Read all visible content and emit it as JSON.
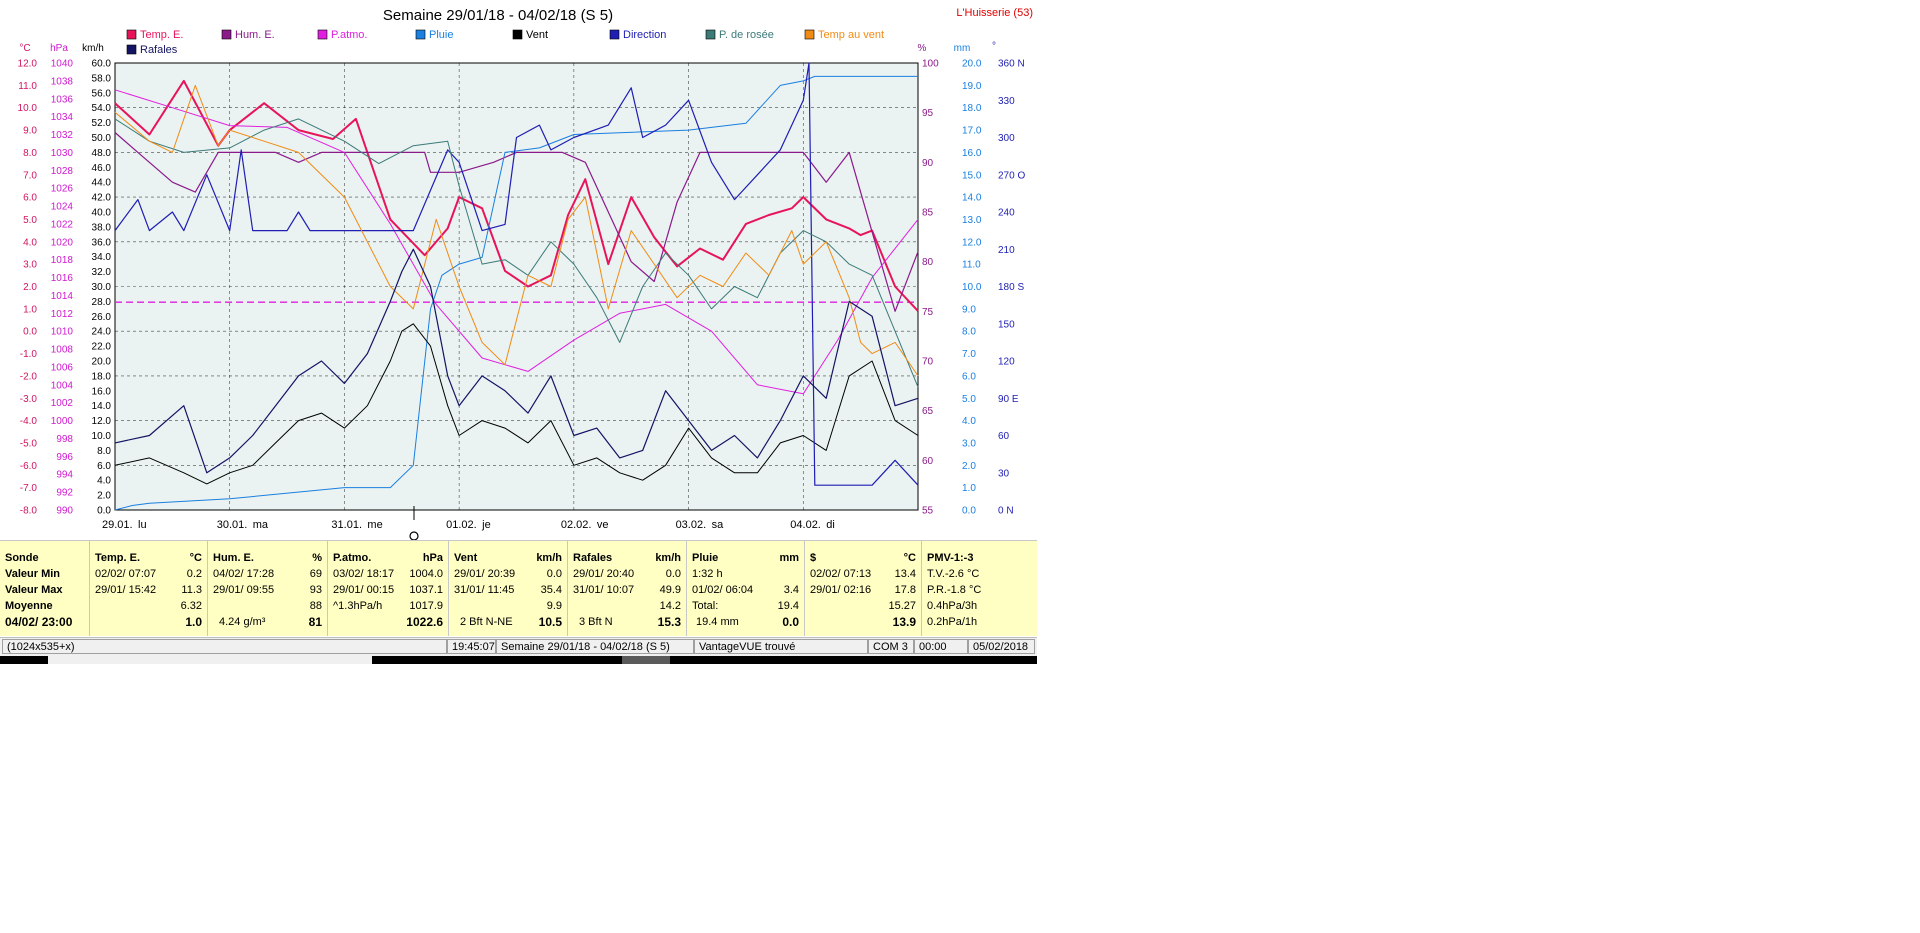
{
  "title": "Semaine 29/01/18 - 04/02/18 (S 5)",
  "station": "L'Huisserie (53)",
  "axis_units": {
    "temp": "°C",
    "press": "hPa",
    "wind": "km/h",
    "hum": "%",
    "rain": "mm",
    "dir": "°"
  },
  "legend": [
    {
      "name": "Temp. E.",
      "color": "#e8145a"
    },
    {
      "name": "Hum. E.",
      "color": "#8b1a8b"
    },
    {
      "name": "P.atmo.",
      "color": "#e020e0"
    },
    {
      "name": "Pluie",
      "color": "#1a7fe0"
    },
    {
      "name": "Vent",
      "color": "#000000"
    },
    {
      "name": "Direction",
      "color": "#1e1eb4"
    },
    {
      "name": "P. de rosée",
      "color": "#3c7a78"
    },
    {
      "name": "Temp au vent",
      "color": "#f08c14"
    },
    {
      "name": "Rafales",
      "color": "#141464"
    }
  ],
  "chart_data": {
    "type": "line",
    "title": "Semaine 29/01/18 - 04/02/18 (S 5)",
    "x_labels": [
      "29.01.",
      "lu",
      "30.01.",
      "ma",
      "31.01.",
      "me",
      "01.02.",
      "je",
      "02.02.",
      "ve",
      "03.02.",
      "sa",
      "04.02.",
      "di"
    ],
    "day_labels": [
      {
        "date": "29.01.",
        "day": "lu"
      },
      {
        "date": "30.01.",
        "day": "ma"
      },
      {
        "date": "31.01.",
        "day": "me"
      },
      {
        "date": "01.02.",
        "day": "je"
      },
      {
        "date": "02.02.",
        "day": "ve"
      },
      {
        "date": "03.02.",
        "day": "sa"
      },
      {
        "date": "04.02.",
        "day": "di"
      }
    ],
    "x_range_days": [
      0,
      7
    ],
    "axes": {
      "temp": {
        "range": [
          -8,
          12
        ],
        "ticks": [
          "12.0",
          "11.0",
          "10.0",
          "9.0",
          "8.0",
          "7.0",
          "6.0",
          "5.0",
          "4.0",
          "3.0",
          "2.0",
          "1.0",
          "0.0",
          "-1.0",
          "-2.0",
          "-3.0",
          "-4.0",
          "-5.0",
          "-6.0",
          "-7.0",
          "-8.0"
        ]
      },
      "press": {
        "range": [
          990,
          1040
        ],
        "ticks": [
          "1040",
          "1038",
          "1036",
          "1034",
          "1032",
          "1030",
          "1028",
          "1026",
          "1024",
          "1022",
          "1020",
          "1018",
          "1016",
          "1014",
          "1012",
          "1010",
          "1008",
          "1006",
          "1004",
          "1002",
          "1000",
          "998",
          "996",
          "994",
          "992",
          "990"
        ]
      },
      "wind": {
        "range": [
          0,
          60
        ],
        "ticks": [
          "60.0",
          "58.0",
          "56.0",
          "54.0",
          "52.0",
          "50.0",
          "48.0",
          "46.0",
          "44.0",
          "42.0",
          "40.0",
          "38.0",
          "36.0",
          "34.0",
          "32.0",
          "30.0",
          "28.0",
          "26.0",
          "24.0",
          "22.0",
          "20.0",
          "18.0",
          "16.0",
          "14.0",
          "12.0",
          "10.0",
          "8.0",
          "6.0",
          "4.0",
          "2.0",
          "0.0"
        ]
      },
      "hum": {
        "range": [
          55,
          100
        ],
        "ticks": [
          "100",
          "95",
          "90",
          "85",
          "80",
          "75",
          "70",
          "65",
          "60",
          "55"
        ]
      },
      "rain": {
        "range": [
          0,
          20
        ],
        "ticks": [
          "20.0",
          "19.0",
          "18.0",
          "17.0",
          "16.0",
          "15.0",
          "14.0",
          "13.0",
          "12.0",
          "11.0",
          "10.0",
          "9.0",
          "8.0",
          "7.0",
          "6.0",
          "5.0",
          "4.0",
          "3.0",
          "2.0",
          "1.0",
          "0.0"
        ]
      },
      "dir": {
        "range": [
          0,
          360
        ],
        "ticks": [
          "360 N",
          "330",
          "300",
          "270 O",
          "240",
          "210",
          "180 S",
          "150",
          "120",
          "90  E",
          "60",
          "30",
          "0    N"
        ]
      }
    },
    "series": [
      {
        "name": "Temp. E.",
        "axis": "temp",
        "color": "#e8145a",
        "width": 2,
        "x": [
          0,
          0.3,
          0.6,
          0.9,
          1.0,
          1.3,
          1.6,
          1.9,
          2.1,
          2.4,
          2.7,
          2.9,
          3.0,
          3.2,
          3.4,
          3.6,
          3.8,
          3.95,
          4.1,
          4.3,
          4.5,
          4.7,
          4.9,
          5.1,
          5.3,
          5.5,
          5.7,
          5.9,
          6.0,
          6.2,
          6.4,
          6.5,
          6.6,
          6.8,
          7.0
        ],
        "y": [
          10.2,
          8.8,
          11.2,
          8.3,
          9.0,
          10.2,
          9.0,
          8.6,
          9.5,
          5.0,
          3.4,
          4.6,
          6.0,
          5.5,
          2.7,
          2.0,
          2.5,
          5.2,
          6.8,
          3.0,
          6.0,
          4.2,
          2.9,
          3.7,
          3.2,
          4.8,
          5.2,
          5.5,
          6.0,
          5.0,
          4.6,
          4.3,
          4.5,
          2.0,
          0.9
        ]
      },
      {
        "name": "Hum. E.",
        "axis": "hum",
        "color": "#8b1a8b",
        "width": 1.2,
        "x": [
          0,
          0.2,
          0.5,
          0.7,
          0.9,
          1.0,
          1.2,
          1.4,
          1.6,
          1.8,
          2.0,
          2.2,
          2.5,
          2.7,
          2.75,
          3.0,
          3.3,
          3.5,
          3.7,
          3.9,
          4.1,
          4.3,
          4.5,
          4.7,
          4.9,
          5.1,
          5.3,
          5.5,
          5.7,
          5.9,
          6.0,
          6.2,
          6.4,
          6.6,
          6.8,
          7.0
        ],
        "y": [
          93,
          91,
          88,
          87,
          91,
          91,
          91,
          91,
          90,
          91,
          91,
          91,
          91,
          91,
          89,
          89,
          90,
          91,
          91,
          91,
          90,
          85,
          80,
          78,
          86,
          91,
          91,
          91,
          91,
          91,
          91,
          88,
          91,
          83,
          75,
          81
        ]
      },
      {
        "name": "P.atmo.",
        "axis": "press",
        "color": "#e020e0",
        "width": 1,
        "x": [
          0,
          0.5,
          1.0,
          1.5,
          2.0,
          2.4,
          2.8,
          3.2,
          3.6,
          4.0,
          4.4,
          4.8,
          5.2,
          5.6,
          6.0,
          6.3,
          6.6,
          7.0
        ],
        "y": [
          1037.0,
          1035.0,
          1033.0,
          1032.8,
          1030.0,
          1022.0,
          1013.0,
          1007.0,
          1005.5,
          1009.0,
          1012.0,
          1013.0,
          1010.0,
          1004.0,
          1003.0,
          1009.0,
          1016.0,
          1022.5
        ]
      },
      {
        "name": "Pluie",
        "axis": "rain",
        "color": "#1a7fe0",
        "width": 1,
        "x": [
          0,
          0.15,
          0.3,
          1.0,
          2.0,
          2.4,
          2.6,
          2.75,
          2.85,
          3.0,
          3.2,
          3.4,
          3.7,
          4.0,
          5.0,
          5.5,
          5.8,
          6.0,
          6.1,
          6.5,
          7.0
        ],
        "y": [
          0,
          0.2,
          0.3,
          0.5,
          1.0,
          1.0,
          2.0,
          9.0,
          10.5,
          11.0,
          11.3,
          16.0,
          16.2,
          16.8,
          17.0,
          17.3,
          19.0,
          19.2,
          19.4,
          19.4,
          19.4
        ]
      },
      {
        "name": "Vent",
        "axis": "wind",
        "color": "#000000",
        "width": 1,
        "x": [
          0,
          0.3,
          0.6,
          0.8,
          1.0,
          1.2,
          1.4,
          1.6,
          1.8,
          2.0,
          2.2,
          2.4,
          2.5,
          2.6,
          2.75,
          2.9,
          3.0,
          3.2,
          3.4,
          3.6,
          3.8,
          4.0,
          4.2,
          4.4,
          4.6,
          4.8,
          5.0,
          5.2,
          5.4,
          5.6,
          5.8,
          6.0,
          6.2,
          6.4,
          6.6,
          6.8,
          7.0
        ],
        "y": [
          6.0,
          7.0,
          5.0,
          3.5,
          5.0,
          6.0,
          9.0,
          12.0,
          13.0,
          11.0,
          14.0,
          20.0,
          24.0,
          25.0,
          22.0,
          14.0,
          10.0,
          12.0,
          11.0,
          9.0,
          12.0,
          6.0,
          7.0,
          5.0,
          4.0,
          6.0,
          11.0,
          7.0,
          5.0,
          5.0,
          9.0,
          10.0,
          8.0,
          18.0,
          20.0,
          12.0,
          10.0
        ]
      },
      {
        "name": "Direction",
        "axis": "dir",
        "color": "#1e1eb4",
        "width": 1.2,
        "x": [
          0,
          0.2,
          0.3,
          0.5,
          0.6,
          0.8,
          1.0,
          1.1,
          1.2,
          1.5,
          1.6,
          1.7,
          2.0,
          2.3,
          2.6,
          2.9,
          3.0,
          3.2,
          3.4,
          3.5,
          3.7,
          3.8,
          4.0,
          4.3,
          4.5,
          4.6,
          4.8,
          5.0,
          5.2,
          5.4,
          5.6,
          5.8,
          6.0,
          6.05,
          6.1,
          6.3,
          6.6,
          6.8,
          7.0
        ],
        "y": [
          225,
          250,
          225,
          240,
          225,
          270,
          225,
          290,
          225,
          225,
          240,
          225,
          225,
          225,
          225,
          290,
          280,
          225,
          230,
          300,
          310,
          290,
          300,
          310,
          340,
          300,
          310,
          330,
          280,
          250,
          270,
          290,
          330,
          360,
          20,
          20,
          20,
          40,
          20
        ]
      },
      {
        "name": "P. de rosée",
        "axis": "temp",
        "color": "#3c7a78",
        "width": 1,
        "x": [
          0,
          0.3,
          0.6,
          1.0,
          1.3,
          1.6,
          2.0,
          2.3,
          2.6,
          2.9,
          3.0,
          3.2,
          3.4,
          3.6,
          3.8,
          4.0,
          4.2,
          4.4,
          4.6,
          4.8,
          5.0,
          5.2,
          5.4,
          5.6,
          5.8,
          6.0,
          6.2,
          6.4,
          6.6,
          7.0
        ],
        "y": [
          9.5,
          8.5,
          8.0,
          8.2,
          9.0,
          9.5,
          8.5,
          7.5,
          8.3,
          8.5,
          6.5,
          3.0,
          3.2,
          2.5,
          4.0,
          3.0,
          1.5,
          -0.5,
          2.0,
          3.5,
          2.5,
          1.0,
          2.0,
          1.5,
          3.5,
          4.5,
          4.0,
          3.0,
          2.5,
          -2.5
        ]
      },
      {
        "name": "Temp au vent",
        "axis": "temp",
        "color": "#f08c14",
        "width": 1,
        "x": [
          0,
          0.3,
          0.5,
          0.7,
          0.9,
          1.0,
          1.3,
          1.6,
          2.0,
          2.4,
          2.6,
          2.8,
          3.0,
          3.2,
          3.4,
          3.6,
          3.8,
          3.95,
          4.1,
          4.3,
          4.5,
          4.7,
          4.9,
          5.1,
          5.3,
          5.5,
          5.7,
          5.9,
          6.0,
          6.2,
          6.4,
          6.5,
          6.6,
          6.8,
          7.0
        ],
        "y": [
          9.8,
          8.5,
          8.0,
          11.0,
          8.3,
          9.0,
          8.5,
          8.0,
          6.0,
          2.0,
          1.0,
          5.0,
          2.0,
          -0.5,
          -1.5,
          2.5,
          2.0,
          5.0,
          6.0,
          1.0,
          4.5,
          3.0,
          1.5,
          2.5,
          2.0,
          3.5,
          2.5,
          4.5,
          3.0,
          4.0,
          1.5,
          -0.5,
          -1.0,
          -0.5,
          -2.0
        ]
      },
      {
        "name": "Rafales",
        "axis": "wind",
        "color": "#141464",
        "width": 1.2,
        "x": [
          0,
          0.3,
          0.6,
          0.8,
          1.0,
          1.2,
          1.4,
          1.6,
          1.8,
          2.0,
          2.2,
          2.4,
          2.5,
          2.6,
          2.75,
          2.9,
          3.0,
          3.2,
          3.4,
          3.6,
          3.8,
          4.0,
          4.2,
          4.4,
          4.6,
          4.8,
          5.0,
          5.2,
          5.4,
          5.6,
          5.8,
          6.0,
          6.2,
          6.4,
          6.6,
          6.8,
          7.0
        ],
        "y": [
          9.0,
          10.0,
          14.0,
          5.0,
          7.0,
          10.0,
          14.0,
          18.0,
          20.0,
          17.0,
          21.0,
          28.0,
          32.0,
          35.0,
          30.0,
          18.0,
          14.0,
          18.0,
          16.0,
          13.0,
          18.0,
          10.0,
          11.0,
          7.0,
          8.0,
          16.0,
          12.0,
          8.0,
          10.0,
          7.0,
          12.0,
          18.0,
          15.0,
          28.0,
          26.0,
          14.0,
          15.0
        ]
      }
    ],
    "reference_line": {
      "axis": "press",
      "value": 1013.25,
      "color": "#e020e0",
      "dashed": true
    },
    "grid": true,
    "legend_position": "top"
  },
  "stats": {
    "sonde": {
      "header": "Sonde",
      "rows": [
        "Valeur Min",
        "Valeur Max",
        "Moyenne",
        "04/02/ 23:00"
      ]
    },
    "temp": {
      "title": "Temp. E.",
      "unit": "°C",
      "min_time": "02/02/ 07:07",
      "min": "0.2",
      "max_time": "29/01/ 15:42",
      "max": "11.3",
      "avg": "6.32",
      "cur": "1.0"
    },
    "hum": {
      "title": "Hum. E.",
      "unit": "%",
      "min_time": "04/02/ 17:28",
      "min": "69",
      "max_time": "29/01/ 09:55",
      "max": "93",
      "avg": "88",
      "cur_extra": "4.24 g/m³",
      "cur": "81"
    },
    "press": {
      "title": "P.atmo.",
      "unit": "hPa",
      "min_time": "03/02/ 18:17",
      "min": "1004.0",
      "max_time": "29/01/ 00:15",
      "max": "1037.1",
      "trend": "^1.3hPa/h",
      "avg": "1017.9",
      "cur": "1022.6"
    },
    "wind": {
      "title": "Vent",
      "unit": "km/h",
      "min_time": "29/01/ 20:39",
      "min": "0.0",
      "max_time": "31/01/ 11:45",
      "max": "35.4",
      "avg": "9.9",
      "cur_extra": "2 Bft N-NE",
      "cur": "10.5"
    },
    "gust": {
      "title": "Rafales",
      "unit": "km/h",
      "min_time": "29/01/ 20:40",
      "min": "0.0",
      "max_time": "31/01/ 10:07",
      "max": "49.9",
      "avg": "14.2",
      "cur_extra": "3 Bft N",
      "cur": "15.3"
    },
    "rain": {
      "title": "Pluie",
      "unit": "mm",
      "min_time": "1:32 h",
      "max_time": "01/02/ 06:04",
      "max": "3.4",
      "total_label": "Total:",
      "total": "19.4",
      "cur_extra": "19.4 mm",
      "cur": "0.0"
    },
    "dollar": {
      "title": "$",
      "unit": "°C",
      "min_time": "02/02/ 07:13",
      "min": "13.4",
      "max_time": "29/01/ 02:16",
      "max": "17.8",
      "avg": "15.27",
      "cur": "13.9"
    },
    "pmv": {
      "title": "PMV-1:-3",
      "r1": "T.V.-2.6 °C",
      "r2": "P.R.-1.8 °C",
      "r3": "0.4hPa/3h",
      "r4": "0.2hPa/1h"
    }
  },
  "status_bar": {
    "size": "(1024x535+x)",
    "time": "19:45:07",
    "period": "Semaine 29/01/18 - 04/02/18 (S 5)",
    "station": "VantageVUE trouvé",
    "port": "COM 3",
    "clock": "00:00",
    "date": "05/02/2018"
  }
}
